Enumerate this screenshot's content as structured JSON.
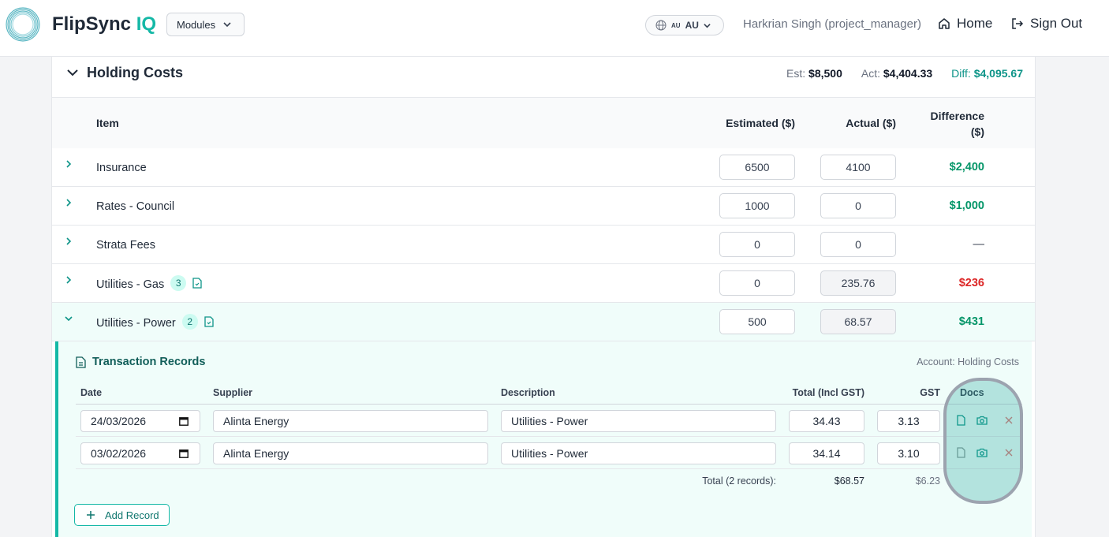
{
  "header": {
    "brand_main": "FlipSync",
    "brand_accent": "IQ",
    "modules_label": "Modules",
    "lang_flag": "AU",
    "lang_label": "AU",
    "user": "Harkrian Singh (project_manager)",
    "home_label": "Home",
    "signout_label": "Sign Out"
  },
  "section": {
    "title": "Holding Costs",
    "est_label": "Est:",
    "est_value": "$8,500",
    "act_label": "Act:",
    "act_value": "$4,404.33",
    "diff_label": "Diff:",
    "diff_value": "$4,095.67"
  },
  "table": {
    "columns": {
      "item": "Item",
      "estimated": "Estimated ($)",
      "actual": "Actual ($)",
      "difference_1": "Difference",
      "difference_2": "($)"
    },
    "rows": [
      {
        "name": "Insurance",
        "badge": "",
        "estimated": "6500",
        "actual": "4100",
        "difference": "$2,400",
        "status": "pos"
      },
      {
        "name": "Rates - Council",
        "badge": "",
        "estimated": "1000",
        "actual": "0",
        "difference": "$1,000",
        "status": "pos"
      },
      {
        "name": "Strata Fees",
        "badge": "",
        "estimated": "0",
        "actual": "0",
        "difference": "—",
        "status": "neutral"
      },
      {
        "name": "Utilities - Gas",
        "badge": "3",
        "estimated": "0",
        "actual": "235.76",
        "difference": "$236",
        "status": "neg"
      },
      {
        "name": "Utilities - Power",
        "badge": "2",
        "estimated": "500",
        "actual": "68.57",
        "difference": "$431",
        "status": "pos"
      }
    ]
  },
  "transactions": {
    "title": "Transaction Records",
    "account": "Account: Holding Costs",
    "columns": {
      "date": "Date",
      "supplier": "Supplier",
      "description": "Description",
      "total": "Total (Incl GST)",
      "gst": "GST",
      "docs": "Docs"
    },
    "records": [
      {
        "date": "24/03/2026",
        "supplier": "Alinta Energy",
        "description": "Utilities - Power",
        "total": "34.43",
        "gst": "3.13"
      },
      {
        "date": "03/02/2026",
        "supplier": "Alinta Energy",
        "description": "Utilities - Power",
        "total": "34.14",
        "gst": "3.10"
      }
    ],
    "totals_label": "Total (2 records):",
    "totals_total": "$68.57",
    "totals_gst": "$6.23",
    "add_label": "Add Record"
  },
  "colors": {
    "accent": "#14b8a6",
    "positive": "#059669",
    "negative": "#dc2626"
  }
}
